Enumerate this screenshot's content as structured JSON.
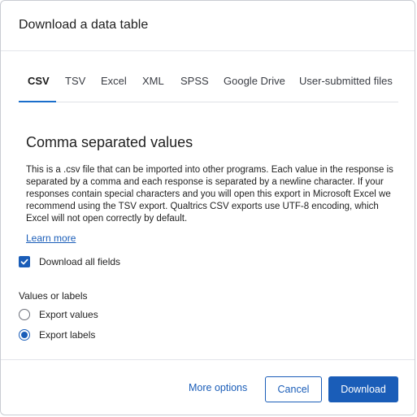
{
  "dialog": {
    "title": "Download a data table"
  },
  "tabs": [
    {
      "label": "CSV",
      "active": true
    },
    {
      "label": "TSV",
      "active": false
    },
    {
      "label": "Excel",
      "active": false
    },
    {
      "label": "XML",
      "active": false
    },
    {
      "label": "SPSS",
      "active": false
    },
    {
      "label": "Google Drive",
      "active": false
    },
    {
      "label": "User-submitted files",
      "active": false
    }
  ],
  "content": {
    "heading": "Comma separated values",
    "description": "This is a .csv file that can be imported into other programs. Each value in the response is separated by a comma and each response is separated by a newline character. If your responses contain special characters and you will open this export in Microsoft Excel we recommend using the TSV export. Qualtrics CSV exports use UTF-8 encoding, which Excel will not open correctly by default.",
    "learn_more": "Learn more",
    "download_all_fields": {
      "label": "Download all fields",
      "checked": true
    },
    "values_group_label": "Values or labels",
    "radio_options": [
      {
        "label": "Export values",
        "checked": false
      },
      {
        "label": "Export labels",
        "checked": true
      }
    ]
  },
  "footer": {
    "more_options": "More options",
    "cancel": "Cancel",
    "download": "Download"
  },
  "colors": {
    "accent": "#1a5db8",
    "tab_underline": "#1a6ecb",
    "border": "#c9ccd3"
  }
}
